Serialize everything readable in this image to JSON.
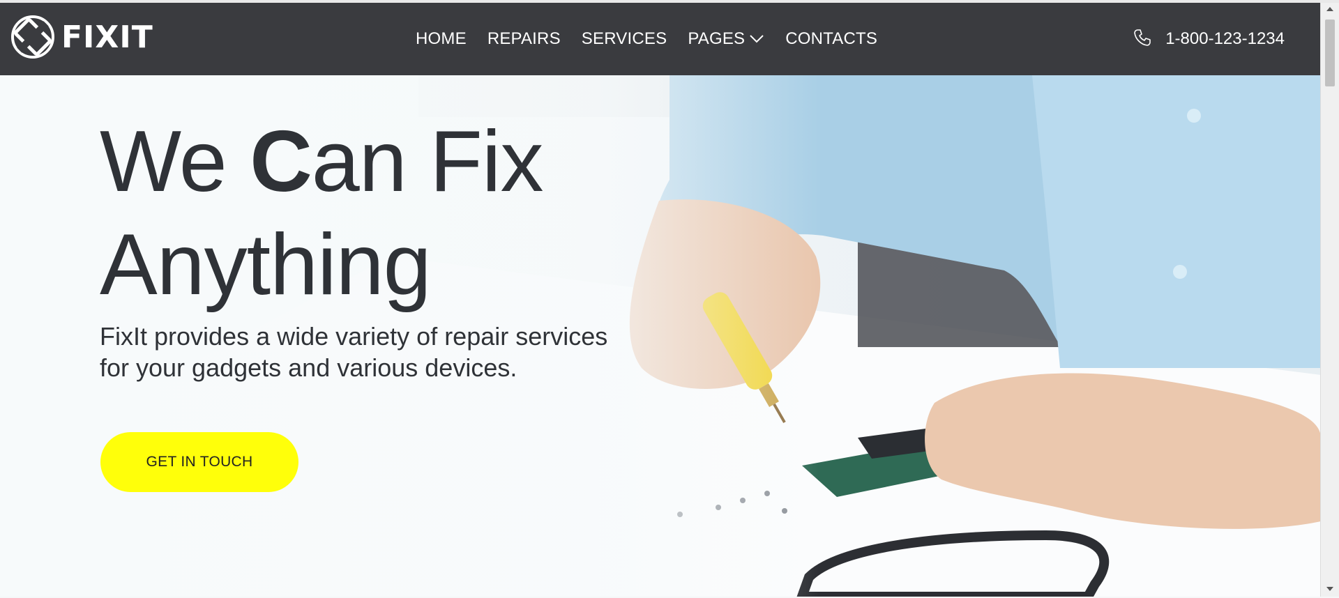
{
  "brand": {
    "name": "FIXIT"
  },
  "nav": {
    "items": [
      {
        "label": "HOME"
      },
      {
        "label": "REPAIRS"
      },
      {
        "label": "SERVICES"
      },
      {
        "label": "PAGES"
      },
      {
        "label": "CONTACTS"
      }
    ]
  },
  "contact": {
    "phone": "1-800-123-1234",
    "icon": "phone-icon"
  },
  "hero": {
    "title_part1": "We ",
    "title_bold": "C",
    "title_part2": "an Fix",
    "title_line2": "Anything",
    "subtitle": "FixIt provides a wide variety of repair services for your gadgets and various devices.",
    "cta_label": "GET IN TOUCH"
  },
  "colors": {
    "navbar": "#3a3b3f",
    "cta": "#ffff0a",
    "text_dark": "#2f3237"
  }
}
